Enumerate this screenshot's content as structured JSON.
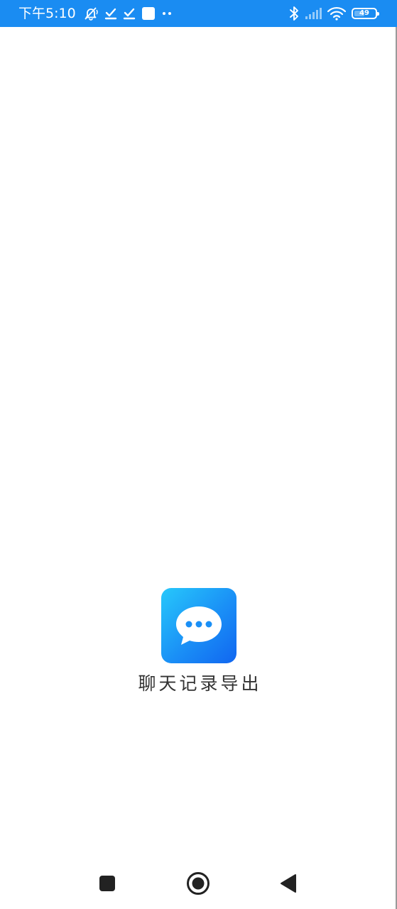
{
  "status_bar": {
    "time": "下午5:10",
    "battery_level": "49",
    "battery_fraction": 0.49,
    "background_color": "#1a8cf2",
    "left_icons": [
      "mute-bell-icon",
      "download-done-icon",
      "download-done-icon",
      "square-notification-icon",
      "more-dots-icon"
    ],
    "right_icons": [
      "bluetooth-icon",
      "cellular-signal-icon",
      "wifi-icon",
      "battery-icon"
    ]
  },
  "splash": {
    "app_name": "聊天记录导出",
    "app_icon": "chat-bubble-icon",
    "icon_gradient": [
      "#27c8fb",
      "#1166f0"
    ]
  },
  "nav_bar": {
    "buttons": [
      "recents-square-icon",
      "home-circle-icon",
      "back-triangle-icon"
    ]
  }
}
